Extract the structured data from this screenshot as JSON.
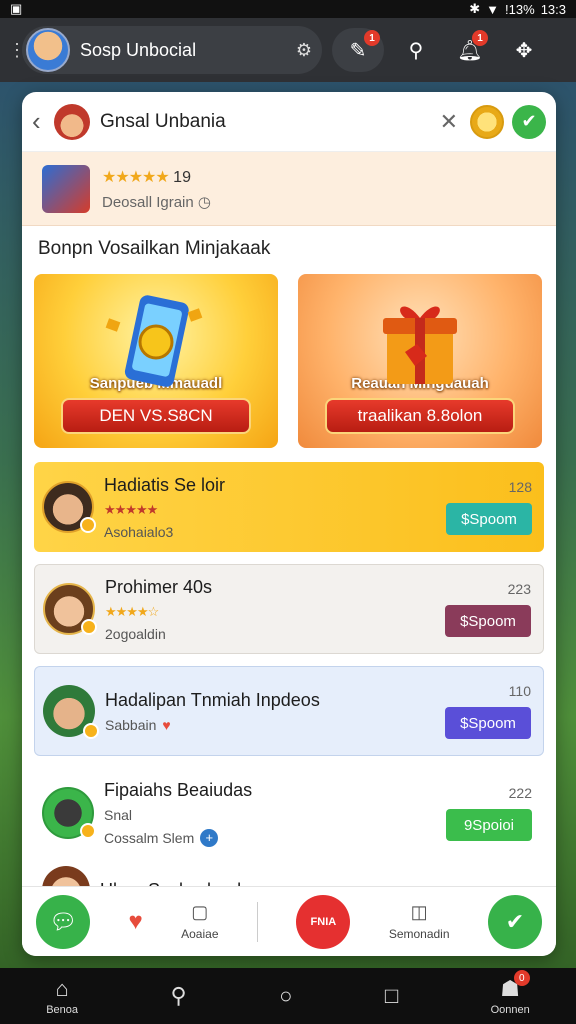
{
  "status_bar": {
    "signal_text": "!13%",
    "time": "13:3"
  },
  "app_bar": {
    "title": "Sosp Unbocial",
    "chat_badge": "1",
    "bell_badge": "1"
  },
  "sheet": {
    "header_title": "Gnsal Unbania",
    "game": {
      "rating": "19",
      "subtitle": "Deosall Igrain"
    },
    "section_title": "Bonpn Vosailkan Minjakaak",
    "promos": [
      {
        "label": "Sanpueb Mmauadl",
        "button": "DEN VS.S8CN"
      },
      {
        "label": "Reauah Minguauah",
        "button": "traalikan 8.8olon"
      }
    ],
    "offers": [
      {
        "title": "Hadiatis Se loir",
        "subtitle": "Asohaialo3",
        "number": "128",
        "button": "$Spoom"
      },
      {
        "title": "Prohimer 40s",
        "subtitle": "2ogoaldin",
        "number": "223",
        "button": "$Spoom"
      },
      {
        "title": "Hadalipan Tnmiah Inpdeos",
        "subtitle": "Sabbain",
        "number": "110",
        "button": "$Spoom"
      },
      {
        "title": "Fipaiahs Beaiudas",
        "subtitle": "Snal",
        "extra": "Cossalm Slem",
        "number": "222",
        "button": "9Spoioi"
      }
    ],
    "partial_item": {
      "title": "Ubep Sackesbaol"
    },
    "actions": {
      "left_label": "Aoaiae",
      "badge_text": "FNIA",
      "right_label": "Semonadin"
    }
  },
  "sys_nav": {
    "home_label": "Benoa",
    "right_label": "Oonnen",
    "badge": "0"
  }
}
